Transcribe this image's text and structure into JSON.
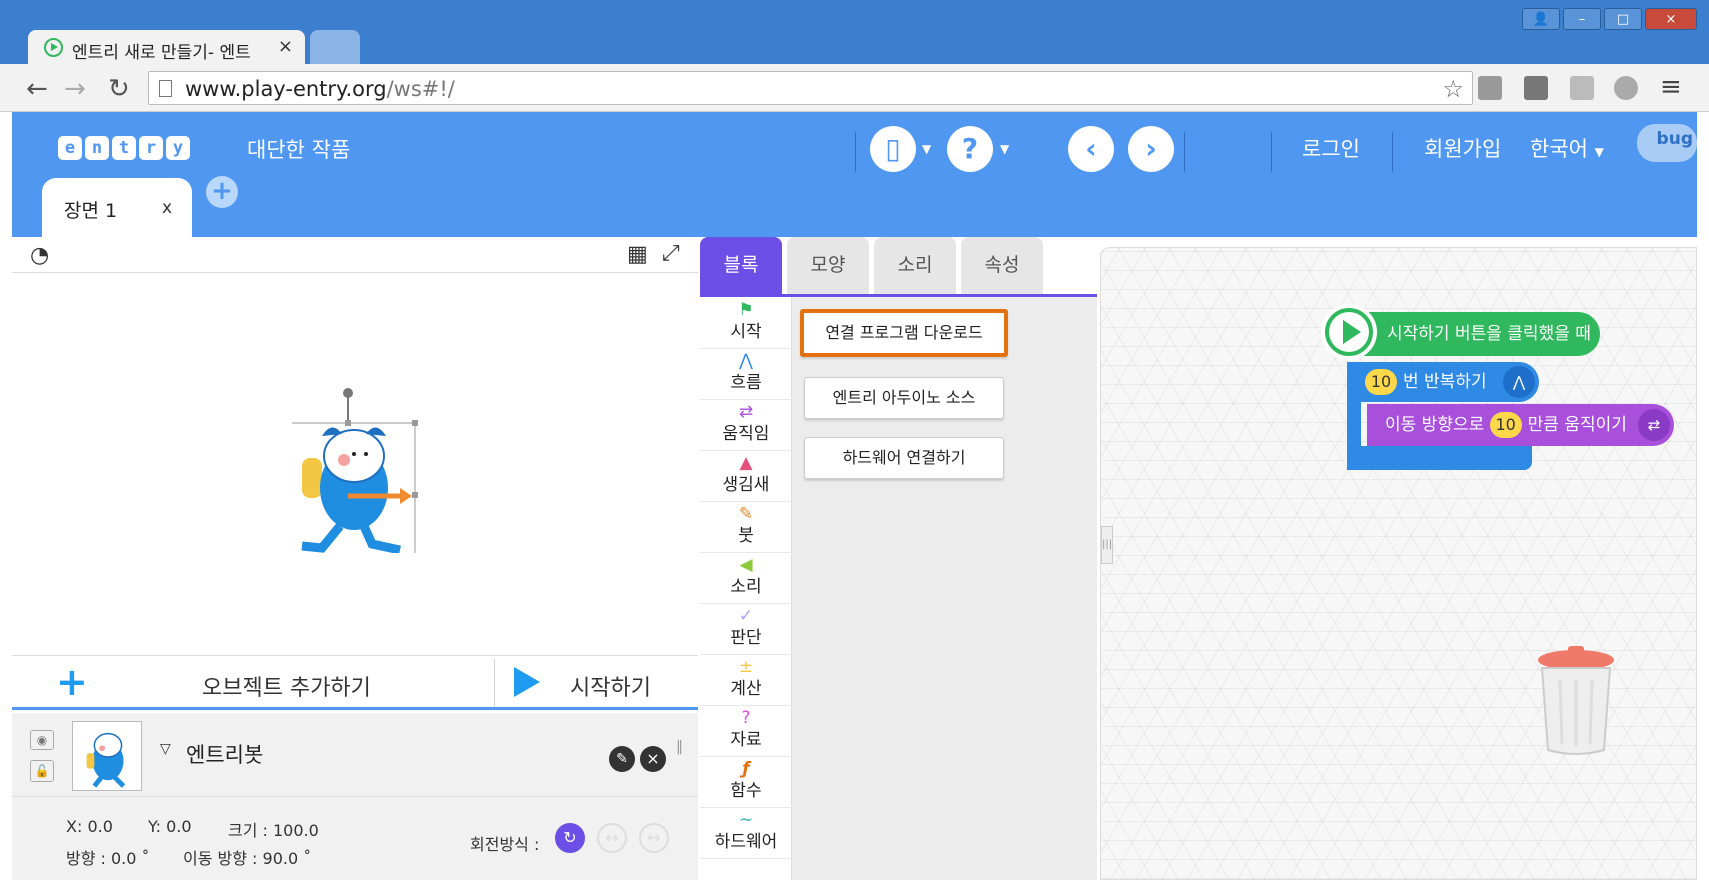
{
  "browser": {
    "tab_title": "엔트리 새로 만들기- 엔트",
    "tab_close": "×",
    "url_domain": "www.play-entry.org",
    "url_path": "/ws#!/",
    "window_buttons": [
      "min",
      "max",
      "close"
    ]
  },
  "header": {
    "logo_letters": [
      "e",
      "n",
      "t",
      "r",
      "y"
    ],
    "project_title": "대단한 작품",
    "login": "로그인",
    "signup": "회원가입",
    "language": "한국어",
    "bug_label": "bug"
  },
  "scene": {
    "tab_label": "장면 1",
    "tab_close": "x"
  },
  "stage": {
    "add_object": "오브젝트 추가하기",
    "start": "시작하기"
  },
  "object": {
    "name": "엔트리봇",
    "x": "X: 0.0",
    "y": "Y: 0.0",
    "size": "크기 : 100.0",
    "direction": "방향 : 0.0 ˚",
    "move_direction": "이동 방향 : 90.0 ˚",
    "rotation_label": "회전방식 :"
  },
  "block_tabs": [
    "블록",
    "모양",
    "소리",
    "속성"
  ],
  "categories": [
    {
      "label": "시작",
      "icon": "flag-icon",
      "color": "#2fb85d"
    },
    {
      "label": "흐름",
      "icon": "flow-icon",
      "color": "#2f8ae6"
    },
    {
      "label": "움직임",
      "icon": "move-icon",
      "color": "#a84fdc"
    },
    {
      "label": "생김새",
      "icon": "shape-icon",
      "color": "#e6507a"
    },
    {
      "label": "붓",
      "icon": "brush-icon",
      "color": "#f08a2f"
    },
    {
      "label": "소리",
      "icon": "speaker-icon",
      "color": "#8ccc3a"
    },
    {
      "label": "판단",
      "icon": "check-icon",
      "color": "#a0a8f0"
    },
    {
      "label": "계산",
      "icon": "calc-icon",
      "color": "#f2c744"
    },
    {
      "label": "자료",
      "icon": "question-icon",
      "color": "#d94fd6"
    },
    {
      "label": "함수",
      "icon": "function-icon",
      "color": "#e5700f"
    },
    {
      "label": "하드웨어",
      "icon": "hardware-icon",
      "color": "#2fb8b0"
    }
  ],
  "palette_buttons": [
    "연결 프로그램 다운로드",
    "엔트리 아두이노 소스",
    "하드웨어 연결하기"
  ],
  "code_blocks": {
    "start": "시작하기 버튼을 클릭했을 때",
    "repeat_count": "10",
    "repeat_label": "번 반복하기",
    "move_prefix": "이동 방향으로",
    "move_value": "10",
    "move_suffix": "만큼 움직이기"
  },
  "colors": {
    "header_blue": "#4f97f0",
    "block_tab_purple": "#6b4fe6",
    "highlight_orange": "#e5700f",
    "start_green": "#2fb85d",
    "flow_blue": "#2f8ae6",
    "move_purple": "#a84fdc"
  }
}
